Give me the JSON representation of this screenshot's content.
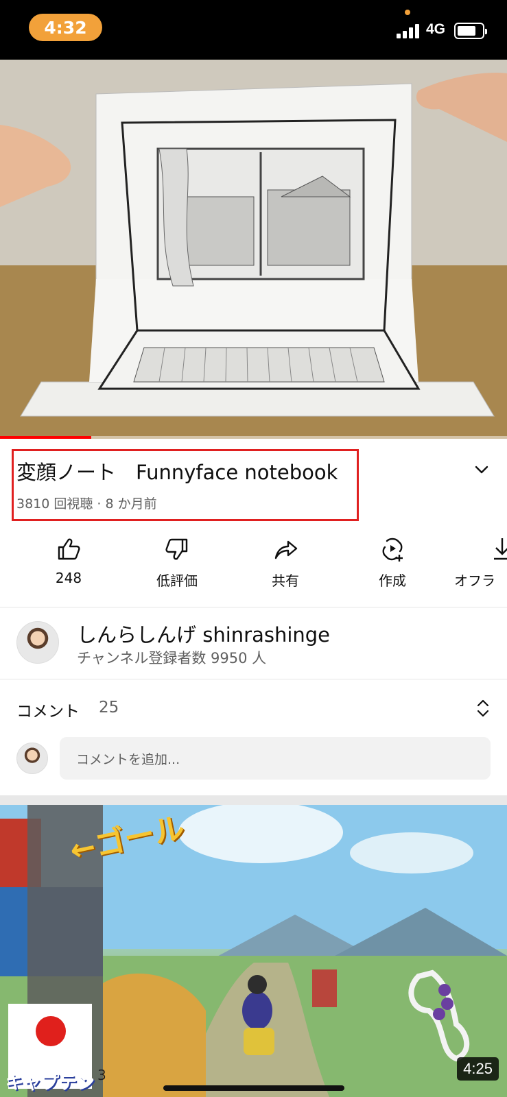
{
  "status_bar": {
    "time": "4:32",
    "network": "4G"
  },
  "video": {
    "progress_fraction": 0.18,
    "title": "変顔ノート　Funnyface notebook",
    "meta": "3810 回視聴 · 8 か月前"
  },
  "actions": [
    {
      "label": "248",
      "icon": "thumbs-up-icon"
    },
    {
      "label": "低評価",
      "icon": "thumbs-down-icon"
    },
    {
      "label": "共有",
      "icon": "share-icon"
    },
    {
      "label": "作成",
      "icon": "create-icon"
    },
    {
      "label": "オフラ",
      "icon": "download-icon"
    }
  ],
  "channel": {
    "name": "しんらしんげ shinrashinge",
    "subscribers": "チャンネル登録者数 9950 人"
  },
  "comments": {
    "label": "コメント",
    "count": "25",
    "placeholder": "コメントを追加..."
  },
  "next_video": {
    "duration": "4:25",
    "overlay_goal": "←ゴール",
    "overlay_captain": "キャプテン",
    "overlay_number": "3"
  },
  "colors": {
    "accent_orange": "#f2a13a",
    "progress_red": "#ff0000",
    "highlight_box": "#e02020"
  }
}
